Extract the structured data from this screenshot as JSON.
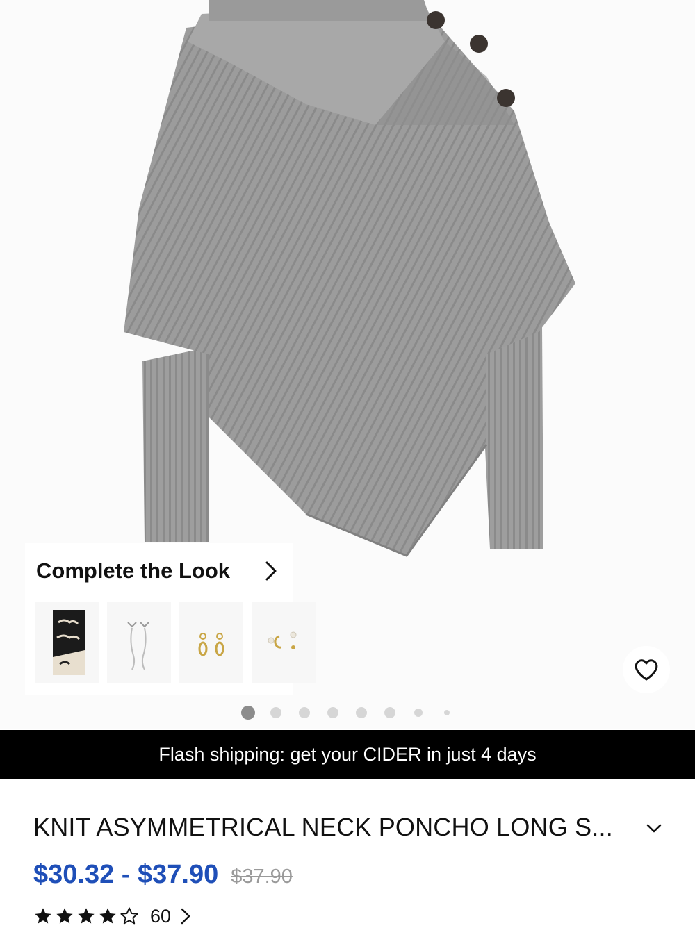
{
  "product_image": {
    "alt": "gray ribbed knit asymmetrical neck poncho sweater",
    "colors": {
      "knit": "#9a9a9a",
      "knit_shadow": "#7e7e7e",
      "button": "#3b3430"
    }
  },
  "complete_the_look": {
    "title": "Complete the Look",
    "arrow_icon": "chevron-right-icon",
    "items": [
      {
        "name": "leopard-print-scarf"
      },
      {
        "name": "butterfly-drop-earrings"
      },
      {
        "name": "gold-hoop-earrings"
      },
      {
        "name": "pearl-earrings"
      }
    ]
  },
  "wishlist": {
    "icon": "heart-icon"
  },
  "carousel": {
    "count": 8,
    "active_index": 0
  },
  "banner": {
    "text": "Flash shipping: get your CIDER in just 4 days"
  },
  "product": {
    "title": "KNIT ASYMMETRICAL NECK PONCHO LONG S...",
    "expand_icon": "chevron-down-icon",
    "price_range": "$30.32 - $37.90",
    "original_price": "$37.90",
    "price_color": "#1f4fb8",
    "rating": {
      "stars": 4,
      "max": 5,
      "count": "60"
    }
  }
}
